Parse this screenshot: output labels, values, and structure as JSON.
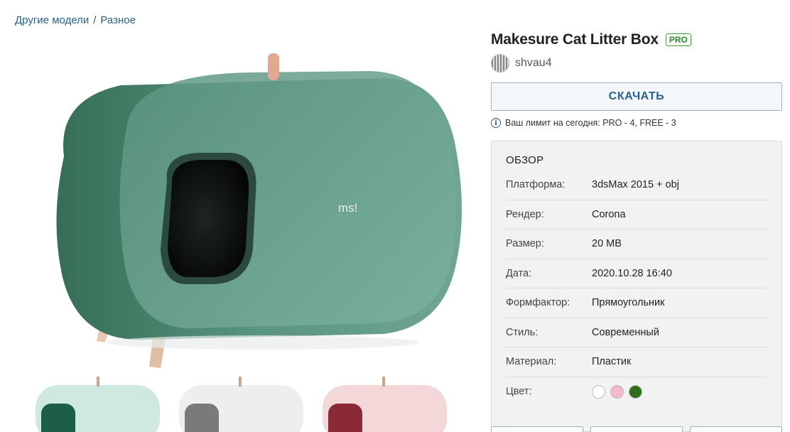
{
  "breadcrumb": {
    "item1": "Другие модели",
    "separator": "/",
    "item2": "Разное"
  },
  "product": {
    "title": "Makesure Cat Litter Box",
    "badge": "PRO",
    "author": "shvau4",
    "logo_text": "ms!"
  },
  "download": {
    "label": "СКАЧАТЬ"
  },
  "limit": {
    "text": "Ваш лимит на сегодня: PRO - 4, FREE - 3"
  },
  "overview": {
    "title": "ОБЗОР",
    "rows": [
      {
        "label": "Платформа:",
        "value": "3dsMax 2015 + obj"
      },
      {
        "label": "Рендер:",
        "value": "Corona"
      },
      {
        "label": "Размер:",
        "value": "20 MB"
      },
      {
        "label": "Дата:",
        "value": "2020.10.28 16:40"
      },
      {
        "label": "Формфактор:",
        "value": "Прямоугольник"
      },
      {
        "label": "Стиль:",
        "value": "Современный"
      },
      {
        "label": "Материал:",
        "value": "Пластик"
      },
      {
        "label": "Цвет:",
        "value": ""
      }
    ],
    "colors": [
      "#ffffff",
      "#f4b8cf",
      "#2e6b1a"
    ]
  },
  "colors": {
    "link": "#2b5f8c",
    "product_green": "#4f8a72",
    "pro_badge": "#3a9a3a"
  }
}
